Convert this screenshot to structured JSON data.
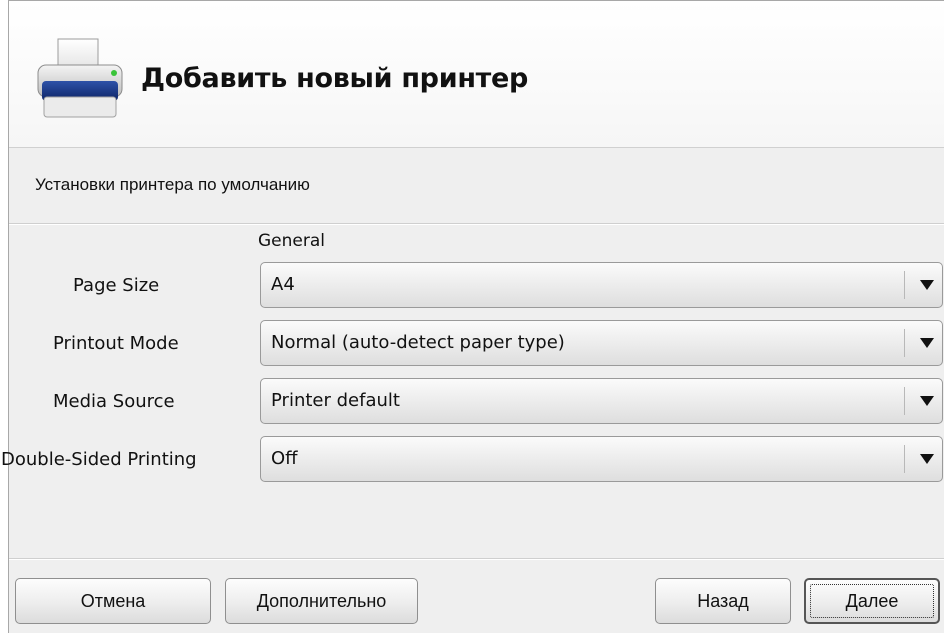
{
  "header": {
    "title": "Добавить новый принтер",
    "icon": "printer-icon"
  },
  "subtitle": "Установки принтера по умолчанию",
  "group": {
    "label": "General"
  },
  "options": [
    {
      "label": "Page Size",
      "value": "A4"
    },
    {
      "label": "Printout Mode",
      "value": "Normal (auto-detect paper type)"
    },
    {
      "label": "Media Source",
      "value": "Printer default"
    },
    {
      "label": "Double-Sided Printing",
      "value": "Off"
    }
  ],
  "buttons": {
    "cancel": "Отмена",
    "advanced": "Дополнительно",
    "back": "Назад",
    "next": "Далее"
  },
  "colors": {
    "window_bg": "#efefef",
    "printer_accent": "#1a3a8a",
    "printer_led": "#39c439"
  }
}
